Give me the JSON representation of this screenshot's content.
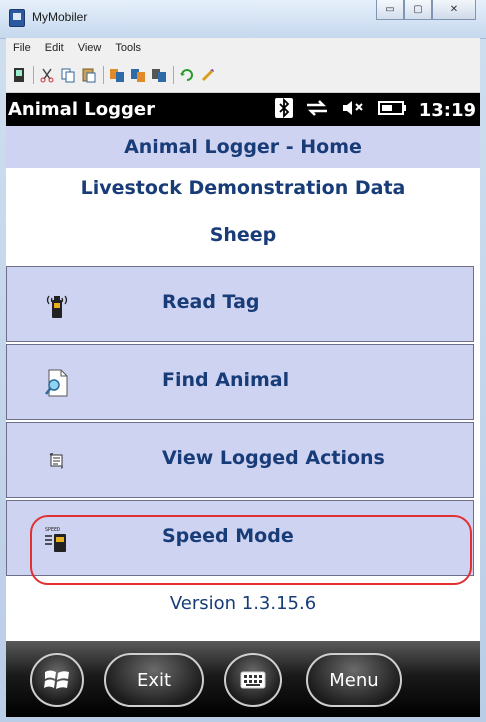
{
  "window": {
    "title": "MyMobiler",
    "caption_minimize": "▭",
    "caption_maximize": "▢",
    "caption_close": "✕"
  },
  "menubar": {
    "items": [
      "File",
      "Edit",
      "View",
      "Tools"
    ]
  },
  "status_bar": {
    "app_name": "Animal Logger",
    "time": "13:19",
    "icons": [
      "bluetooth-icon",
      "data-connection-icon",
      "speaker-muted-icon",
      "battery-icon"
    ]
  },
  "header": {
    "title": "Animal Logger - Home"
  },
  "dataset": {
    "name": "Livestock Demonstration Data",
    "species": "Sheep"
  },
  "menu": {
    "items": [
      {
        "label": "Read Tag",
        "icon": "rfid-reader-icon"
      },
      {
        "label": "Find Animal",
        "icon": "search-document-icon"
      },
      {
        "label": "View Logged Actions",
        "icon": "log-scroll-icon"
      },
      {
        "label": "Speed Mode",
        "icon": "speed-mode-icon",
        "icon_text": "SPEED"
      }
    ]
  },
  "version": "Version 1.3.15.6",
  "softkeys": {
    "left": "Exit",
    "right": "Menu"
  },
  "colors": {
    "accent_text": "#183c78",
    "button_bg": "#cfd3f2",
    "highlight_border": "#e03030"
  }
}
